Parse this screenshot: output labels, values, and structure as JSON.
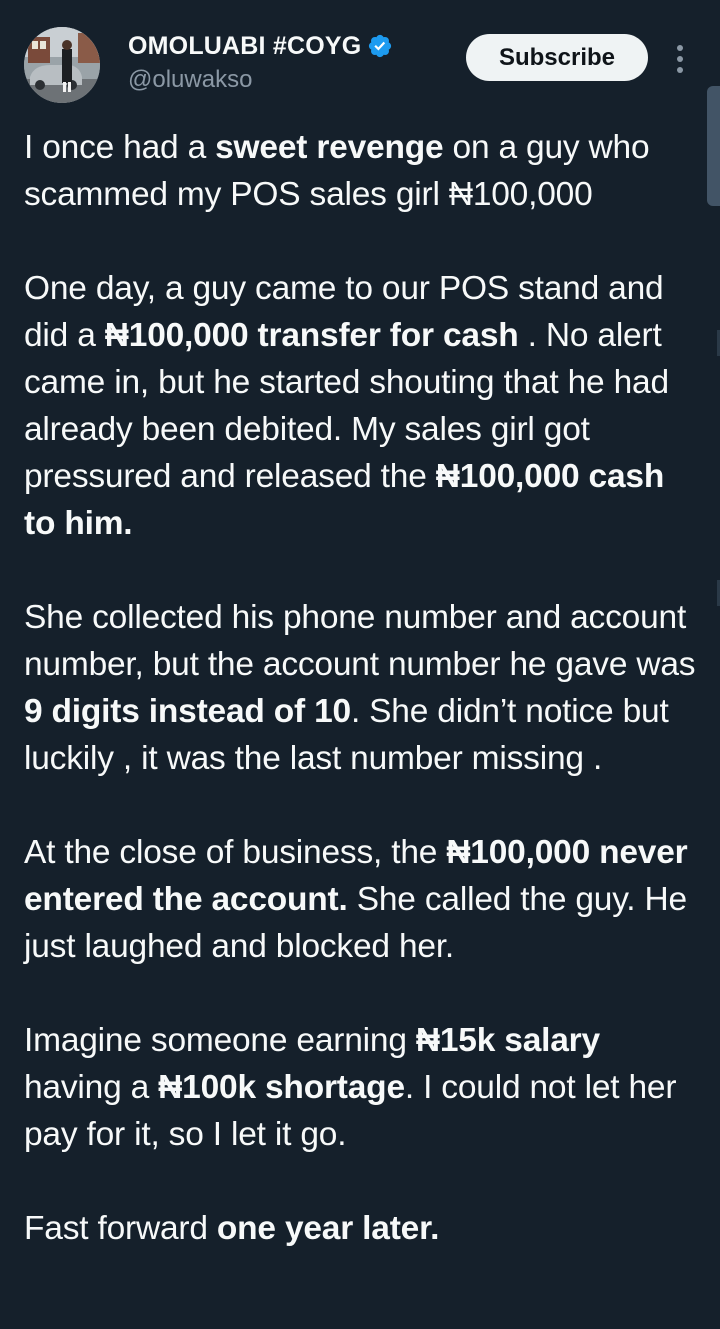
{
  "colors": {
    "background": "#15202b",
    "text_primary": "#f7f9f9",
    "text_secondary": "#8b98a5",
    "verified_badge": "#1d9bf0",
    "subscribe_bg": "#eff3f4"
  },
  "author": {
    "display_name": "OMOLUABI #COYG",
    "handle": "@oluwakso",
    "verified_icon": "verified-badge-icon",
    "avatar_icon": "avatar-photo"
  },
  "actions": {
    "subscribe_label": "Subscribe",
    "more_icon": "more-vertical-icon"
  },
  "tweet": {
    "p1": {
      "a": "I once had a ",
      "b": "sweet revenge",
      "c": " on a guy who scammed my POS sales girl ₦100,000"
    },
    "p2": {
      "a": "One day, a guy came to our POS stand and did a ",
      "b": "₦100,000 transfer for cash",
      "c": " . No alert came in, but he started shouting that he had already been debited. My sales girl got pressured and released the ",
      "d": "₦100,000 cash to him."
    },
    "p3": {
      "a": "She collected his phone number and account number, but the account number he gave was ",
      "b": "9 digits instead of 10",
      "c": ". She didn’t notice but luckily , it was the last number missing ."
    },
    "p4": {
      "a": "At the close of business, the ",
      "b": "₦100,000 never entered the account.",
      "c": " She called the guy. He just laughed and blocked her."
    },
    "p5": {
      "a": "Imagine someone earning ",
      "b": "₦15k salary",
      "c": " having a ",
      "d": "₦100k shortage",
      "e": ". I could not let her pay for it, so I let it go."
    },
    "p6": {
      "a": "Fast forward ",
      "b": "one year later."
    }
  }
}
